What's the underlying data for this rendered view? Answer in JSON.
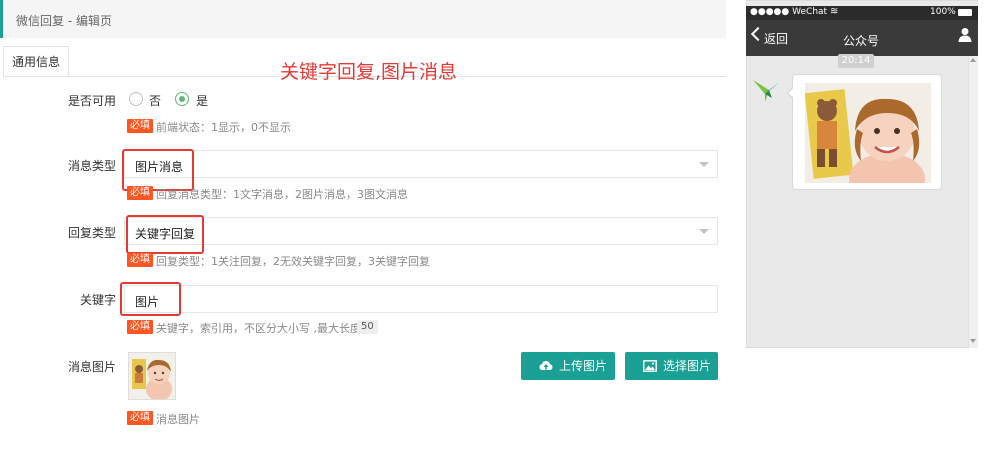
{
  "header": {
    "title": "微信回复 - 编辑页"
  },
  "tabs": [
    {
      "label": "通用信息"
    }
  ],
  "annotation": {
    "text": "关键字回复,图片消息"
  },
  "form": {
    "enabled": {
      "label": "是否可用",
      "options": [
        "否",
        "是"
      ],
      "selected": "是",
      "required": "必填",
      "help": "前端状态：1显示，0不显示"
    },
    "msg_type": {
      "label": "消息类型",
      "value": "图片消息",
      "required": "必填",
      "help": "回复消息类型：1文字消息，2图片消息，3图文消息"
    },
    "reply_type": {
      "label": "回复类型",
      "value": "关键字回复",
      "required": "必填",
      "help": "回复类型：1关注回复，2无效关键字回复，3关键字回复"
    },
    "keyword": {
      "label": "关键字",
      "value": "图片",
      "required": "必填",
      "help": "关键字，索引用，不区分大小写 ,最大长度：",
      "max_len": "50"
    },
    "image": {
      "label": "消息图片",
      "required": "必填",
      "help": "消息图片",
      "upload_label": "上传图片",
      "select_label": "选择图片"
    }
  },
  "phone": {
    "status_left": "●●●●● WeChat",
    "status_right": "100%",
    "back_label": "返回",
    "title": "公众号",
    "time": "20:14"
  },
  "colors": {
    "accent": "#1aa094",
    "required": "#ff5722",
    "annotation": "#e53935",
    "radio_on": "#5fb878"
  }
}
